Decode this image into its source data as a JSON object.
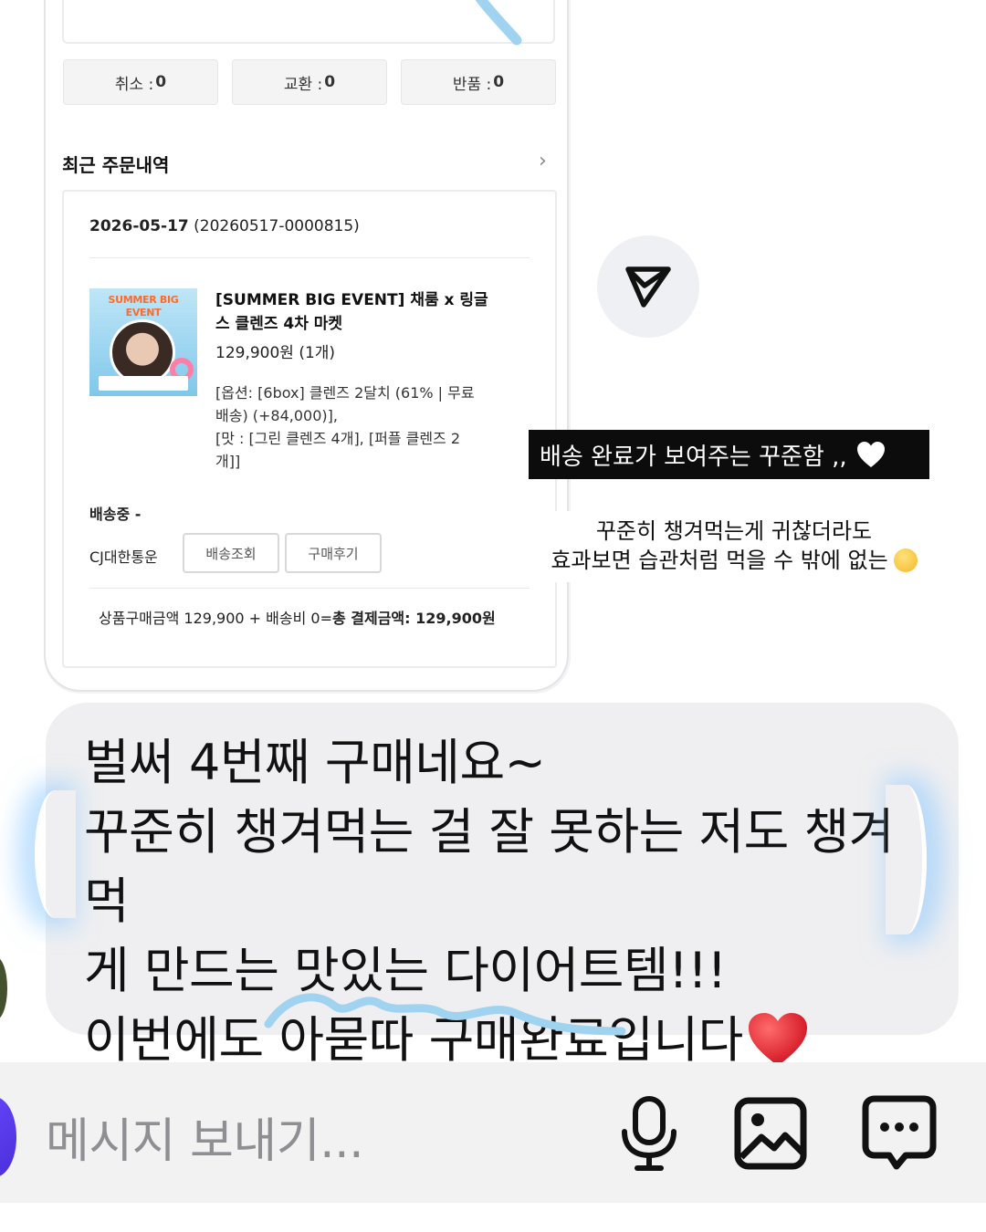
{
  "order_card": {
    "stats": [
      {
        "label": "취소 :",
        "count": "0"
      },
      {
        "label": "교환 :",
        "count": "0"
      },
      {
        "label": "반품 :",
        "count": "0"
      }
    ],
    "recent_title": "최근 주문내역",
    "order": {
      "date": "2026-05-17",
      "order_no": " (20260517-0000815)",
      "thumbnail_text": "SUMMER BIG EVENT",
      "product_name": "[SUMMER BIG EVENT] 채룸 x 링글스 클렌즈 4차 마켓",
      "price": "129,900원 (1개)",
      "options": "[옵션: [6box] 클렌즈 2달치 (61% | 무료 배송) (+84,000)],\n[맛 : [그린 클렌즈 4개], [퍼플 클렌즈 2 개]]",
      "ship_status": "배송중   -",
      "carrier": "CJ대한통운",
      "btn_track": "배송조회",
      "btn_review": "구매후기",
      "total_prefix": "상품구매금액 129,900 + 배송비 0=",
      "total_bold": "총 결제금액: 129,900원"
    }
  },
  "captions": {
    "black": "배송 완료가 보여주는 꾸준함 ,,",
    "white_line1": "꾸준히 챙겨먹는게 귀찮더라도",
    "white_line2": "효과보면 습관처럼 먹을 수 밖에 없는"
  },
  "bubble": {
    "text": "벌써 4번째 구매네요~\n꾸준히 챙겨먹는 걸 잘 못하는 저도 챙겨먹\n게 만드는 맛있는 다이어트템!!!\n이번에도 아묻따 구매완료입니다"
  },
  "composer": {
    "placeholder": "메시지 보내기..."
  },
  "icons": [
    "send-icon",
    "white-heart-icon",
    "shushing-face-icon",
    "red-heart-icon",
    "microphone-icon",
    "gallery-icon",
    "sticker-chat-icon",
    "chevron-right-icon"
  ],
  "colors": {
    "caption_bg": "#0c0c0c",
    "bubble_bg": "#efeff1",
    "scribble": "#9fd3f0",
    "heart_red": "#e8202e"
  }
}
